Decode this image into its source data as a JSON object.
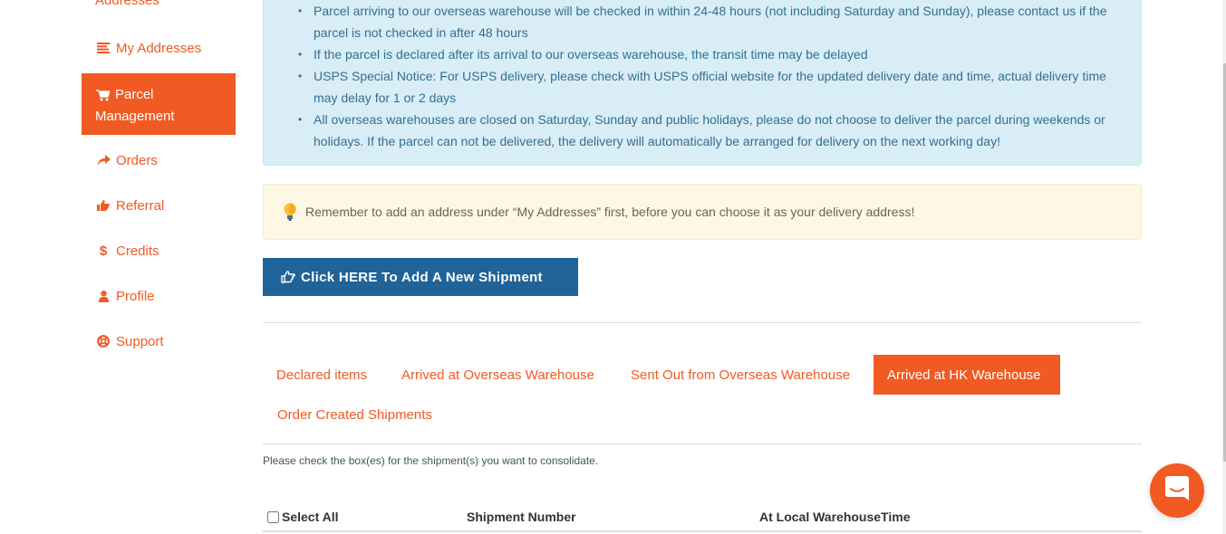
{
  "sidebar": {
    "top_partial_label": "Addresses",
    "items": [
      {
        "label": "My Addresses",
        "icon": "list-icon",
        "active": false
      },
      {
        "label": "Parcel Management",
        "icon": "shopping-cart-icon",
        "active": true
      },
      {
        "label": "Orders",
        "icon": "share-arrow-icon",
        "active": false
      },
      {
        "label": "Referral",
        "icon": "thumbs-up-icon",
        "active": false
      },
      {
        "label": "Credits",
        "icon": "dollar-icon",
        "active": false
      },
      {
        "label": "Profile",
        "icon": "user-icon",
        "active": false
      },
      {
        "label": "Support",
        "icon": "life-ring-icon",
        "active": false
      }
    ]
  },
  "info_notice": {
    "items": [
      "Parcel arriving to our overseas warehouse will be checked in within 24-48 hours (not including Saturday and Sunday), please contact us if the parcel is not checked in after 48 hours",
      "If the parcel is declared after its arrival to our overseas warehouse, the transit time may be delayed",
      "USPS Special Notice: For USPS delivery, please check with USPS official website for the updated delivery date and time, actual delivery time may delay for 1 or 2 days",
      "All overseas warehouses are closed on Saturday, Sunday and public holidays, please do not choose to deliver the parcel during weekends or holidays. If the parcel can not be delivered, the delivery will automatically be arranged for delivery on the next working day!"
    ]
  },
  "warning_notice": {
    "icon": "lightbulb-icon",
    "text": "Remember to add an address under “My Addresses” first, before you can choose it as your delivery address!"
  },
  "add_shipment_button": {
    "icon": "hand-pointer-icon",
    "label": "Click HERE To Add A New Shipment"
  },
  "tabs": [
    {
      "label": "Declared items",
      "active": false
    },
    {
      "label": "Arrived at Overseas Warehouse",
      "active": false
    },
    {
      "label": "Sent Out from Overseas Warehouse",
      "active": false
    },
    {
      "label": "Arrived at HK Warehouse",
      "active": true
    },
    {
      "label": "Order Created Shipments",
      "active": false
    }
  ],
  "consolidate_hint": "Please check the box(es) for the shipment(s) you want to consolidate.",
  "table": {
    "select_all_label": "Select All",
    "select_all_checked": false,
    "columns": [
      "Shipment Number",
      "At Local WarehouseTime"
    ]
  },
  "colors": {
    "brand_orange": "#f15a22",
    "primary_blue": "#1f6399",
    "info_bg": "#d9edf7",
    "warning_bg": "#fcf8e3"
  }
}
